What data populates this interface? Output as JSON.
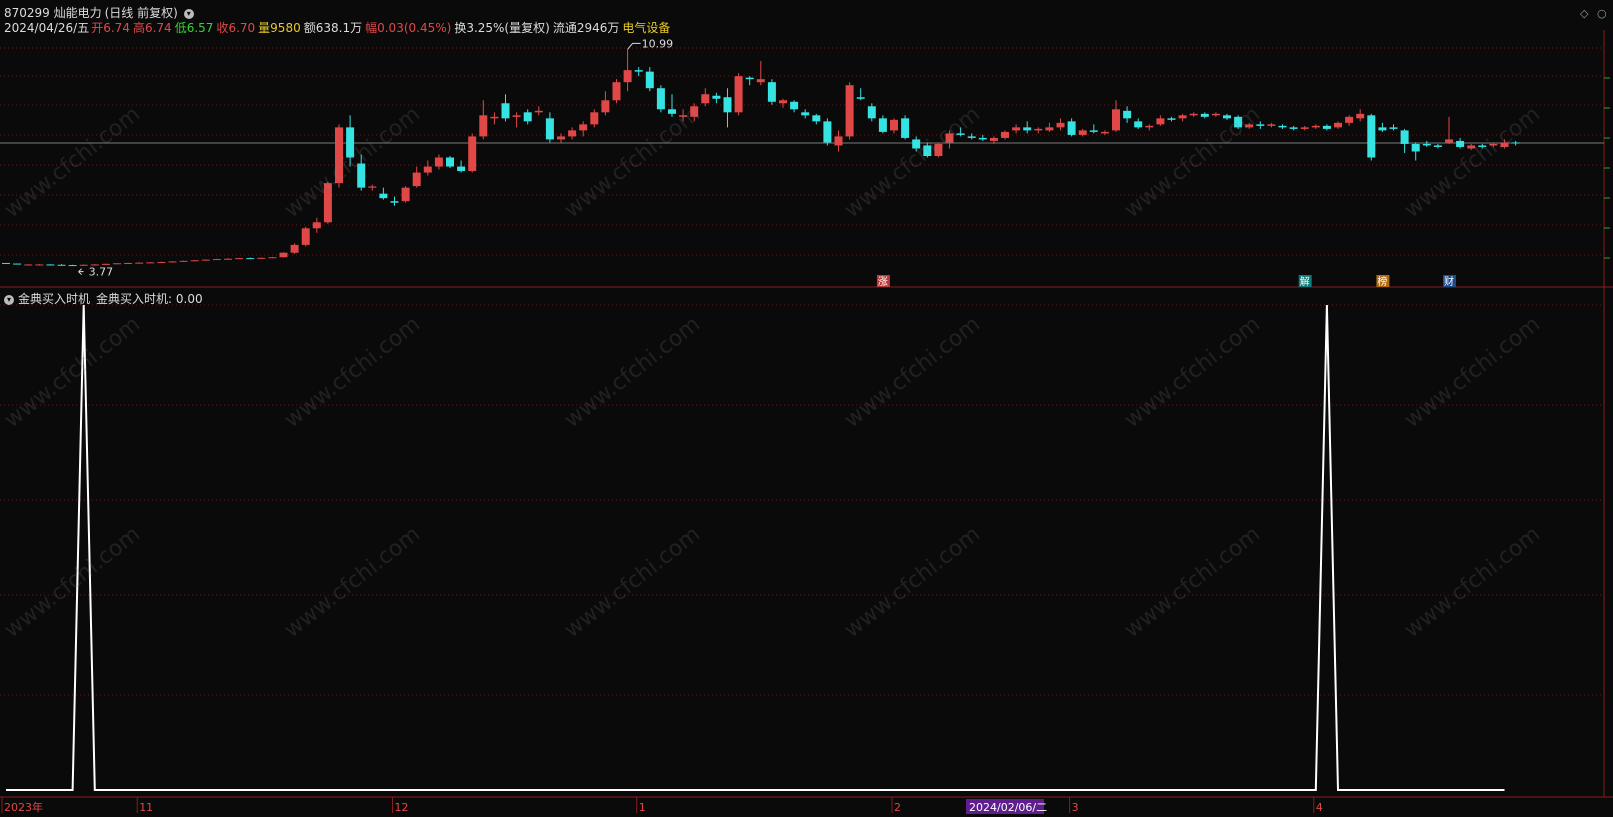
{
  "header": {
    "code_name": "870299 灿能电力",
    "period": "(日线 前复权)",
    "date": "2024/04/26/五",
    "open_label": "开",
    "open": "6.74",
    "high_label": "高",
    "high": "6.74",
    "low_label": "低",
    "low": "6.57",
    "close_label": "收",
    "close": "6.70",
    "vol_label": "量",
    "vol": "9580",
    "amount_label": "额",
    "amount": "638.1万",
    "change_label": "幅",
    "change": "0.03(0.45%)",
    "turnover": "换3.25%(量复权)",
    "float": "流通2946万",
    "sector": "电气设备"
  },
  "indicator": {
    "name": "金典买入时机",
    "value_text": "金典买入时机: 0.00"
  },
  "markers": {
    "high_label": "10.99",
    "low_label": "3.77",
    "events": [
      "涨",
      "解",
      "榜",
      "财"
    ]
  },
  "xaxis": {
    "labels": [
      "2023年",
      "11",
      "12",
      "1",
      "2",
      "3",
      "4"
    ],
    "cursor_date": "2024/02/06/二"
  },
  "watermark": "www.cfchi.com",
  "colors": {
    "up": "#e04848",
    "down": "#35e3e3",
    "bg": "#0a0a0a",
    "grid": "#6a1a1a",
    "line": "#ffffff",
    "accent_yellow": "#e6c829",
    "cursor_bg": "#5e1e8e"
  },
  "chart_data": [
    {
      "type": "candlestick",
      "title": "870299 灿能电力 (日线 前复权)",
      "price_range": [
        3.6,
        11.3
      ],
      "high_marker": 10.99,
      "low_marker": 3.77,
      "candles_ohlc": [
        [
          3.9,
          3.9,
          3.89,
          3.89
        ],
        [
          3.88,
          3.88,
          3.87,
          3.87
        ],
        [
          3.85,
          3.86,
          3.84,
          3.85
        ],
        [
          3.85,
          3.87,
          3.84,
          3.85
        ],
        [
          3.85,
          3.86,
          3.84,
          3.84
        ],
        [
          3.84,
          3.86,
          3.83,
          3.83
        ],
        [
          3.83,
          3.84,
          3.81,
          3.82
        ],
        [
          3.82,
          3.85,
          3.81,
          3.84
        ],
        [
          3.84,
          3.86,
          3.83,
          3.85
        ],
        [
          3.85,
          3.88,
          3.84,
          3.87
        ],
        [
          3.87,
          3.89,
          3.86,
          3.89
        ],
        [
          3.89,
          3.91,
          3.87,
          3.9
        ],
        [
          3.9,
          3.92,
          3.89,
          3.91
        ],
        [
          3.91,
          3.93,
          3.9,
          3.92
        ],
        [
          3.92,
          3.94,
          3.9,
          3.93
        ],
        [
          3.93,
          3.96,
          3.92,
          3.95
        ],
        [
          3.95,
          3.98,
          3.94,
          3.97
        ],
        [
          3.97,
          4.0,
          3.96,
          3.99
        ],
        [
          3.99,
          4.02,
          3.98,
          4.01
        ],
        [
          4.01,
          4.04,
          4.0,
          4.03
        ],
        [
          4.03,
          4.06,
          4.01,
          4.04
        ],
        [
          4.04,
          4.07,
          4.03,
          4.06
        ],
        [
          4.06,
          4.08,
          4.04,
          4.05
        ],
        [
          4.05,
          4.08,
          4.04,
          4.07
        ],
        [
          4.07,
          4.1,
          4.06,
          4.09
        ],
        [
          4.09,
          4.25,
          4.08,
          4.24
        ],
        [
          4.24,
          4.55,
          4.2,
          4.5
        ],
        [
          4.5,
          5.1,
          4.45,
          5.05
        ],
        [
          5.05,
          5.4,
          4.9,
          5.25
        ],
        [
          5.25,
          6.6,
          5.2,
          6.55
        ],
        [
          6.55,
          8.5,
          6.4,
          8.4
        ],
        [
          8.4,
          8.8,
          7.1,
          7.4
        ],
        [
          7.2,
          7.5,
          6.3,
          6.4
        ],
        [
          6.4,
          6.5,
          6.3,
          6.44
        ],
        [
          6.2,
          6.4,
          6.0,
          6.05
        ],
        [
          5.95,
          6.1,
          5.8,
          5.9
        ],
        [
          5.95,
          6.45,
          5.9,
          6.4
        ],
        [
          6.45,
          7.1,
          6.4,
          6.9
        ],
        [
          6.9,
          7.3,
          6.8,
          7.1
        ],
        [
          7.1,
          7.5,
          7.0,
          7.4
        ],
        [
          7.4,
          7.45,
          7.05,
          7.1
        ],
        [
          7.1,
          7.3,
          6.9,
          6.95
        ],
        [
          6.95,
          8.2,
          6.9,
          8.1
        ],
        [
          8.1,
          9.3,
          8.0,
          8.8
        ],
        [
          8.7,
          8.9,
          8.5,
          8.75
        ],
        [
          9.2,
          9.5,
          8.6,
          8.7
        ],
        [
          8.75,
          8.9,
          8.4,
          8.8
        ],
        [
          8.9,
          9.0,
          8.5,
          8.6
        ],
        [
          8.9,
          9.1,
          8.8,
          8.95
        ],
        [
          8.7,
          8.9,
          7.9,
          8.0
        ],
        [
          8.0,
          8.2,
          7.9,
          8.1
        ],
        [
          8.1,
          8.4,
          8.0,
          8.3
        ],
        [
          8.3,
          8.6,
          8.1,
          8.5
        ],
        [
          8.5,
          9.0,
          8.4,
          8.9
        ],
        [
          8.9,
          9.6,
          8.8,
          9.3
        ],
        [
          9.3,
          10.0,
          9.2,
          9.9
        ],
        [
          9.9,
          10.99,
          9.6,
          10.3
        ],
        [
          10.3,
          10.4,
          10.1,
          10.25
        ],
        [
          10.25,
          10.4,
          9.6,
          9.7
        ],
        [
          9.7,
          9.8,
          8.9,
          9.0
        ],
        [
          9.0,
          9.5,
          8.75,
          8.85
        ],
        [
          8.75,
          9.0,
          8.6,
          8.8
        ],
        [
          8.75,
          9.2,
          8.6,
          9.1
        ],
        [
          9.2,
          9.7,
          9.1,
          9.5
        ],
        [
          9.45,
          9.55,
          9.2,
          9.35
        ],
        [
          9.4,
          9.7,
          8.4,
          8.9
        ],
        [
          8.9,
          10.2,
          8.8,
          10.1
        ],
        [
          10.05,
          10.1,
          9.8,
          10.0
        ],
        [
          9.9,
          10.6,
          9.8,
          10.0
        ],
        [
          9.9,
          10.0,
          9.15,
          9.25
        ],
        [
          9.2,
          9.35,
          9.05,
          9.3
        ],
        [
          9.25,
          9.3,
          8.9,
          9.0
        ],
        [
          8.9,
          9.0,
          8.7,
          8.8
        ],
        [
          8.8,
          8.85,
          8.5,
          8.6
        ],
        [
          8.6,
          8.7,
          7.8,
          7.9
        ],
        [
          7.8,
          8.3,
          7.6,
          8.1
        ],
        [
          8.1,
          9.9,
          8.0,
          9.8
        ],
        [
          9.4,
          9.7,
          9.3,
          9.35
        ],
        [
          9.1,
          9.2,
          8.6,
          8.7
        ],
        [
          8.7,
          8.8,
          8.2,
          8.25
        ],
        [
          8.3,
          8.7,
          8.2,
          8.65
        ],
        [
          8.7,
          8.8,
          8.0,
          8.05
        ],
        [
          8.0,
          8.1,
          7.6,
          7.7
        ],
        [
          7.8,
          7.9,
          7.4,
          7.45
        ],
        [
          7.45,
          7.9,
          7.4,
          7.85
        ],
        [
          7.9,
          8.3,
          7.7,
          8.2
        ],
        [
          8.2,
          8.4,
          8.1,
          8.15
        ],
        [
          8.1,
          8.2,
          8.0,
          8.05
        ],
        [
          8.05,
          8.15,
          7.95,
          8.0
        ],
        [
          7.95,
          8.1,
          7.85,
          8.05
        ],
        [
          8.05,
          8.3,
          8.0,
          8.25
        ],
        [
          8.3,
          8.5,
          8.2,
          8.4
        ],
        [
          8.4,
          8.6,
          8.2,
          8.3
        ],
        [
          8.3,
          8.4,
          8.2,
          8.35
        ],
        [
          8.3,
          8.55,
          8.25,
          8.4
        ],
        [
          8.4,
          8.7,
          8.3,
          8.55
        ],
        [
          8.6,
          8.7,
          8.1,
          8.15
        ],
        [
          8.15,
          8.35,
          8.1,
          8.3
        ],
        [
          8.3,
          8.5,
          8.2,
          8.25
        ],
        [
          8.2,
          8.3,
          8.15,
          8.25
        ],
        [
          8.3,
          9.3,
          8.25,
          9.0
        ],
        [
          8.95,
          9.1,
          8.55,
          8.7
        ],
        [
          8.6,
          8.7,
          8.35,
          8.4
        ],
        [
          8.4,
          8.5,
          8.3,
          8.45
        ],
        [
          8.5,
          8.8,
          8.45,
          8.7
        ],
        [
          8.7,
          8.75,
          8.6,
          8.65
        ],
        [
          8.7,
          8.85,
          8.6,
          8.8
        ],
        [
          8.8,
          8.9,
          8.75,
          8.85
        ],
        [
          8.85,
          8.9,
          8.7,
          8.75
        ],
        [
          8.8,
          8.9,
          8.75,
          8.85
        ],
        [
          8.8,
          8.85,
          8.65,
          8.7
        ],
        [
          8.75,
          8.8,
          8.35,
          8.4
        ],
        [
          8.4,
          8.55,
          8.35,
          8.5
        ],
        [
          8.5,
          8.6,
          8.35,
          8.45
        ],
        [
          8.45,
          8.55,
          8.4,
          8.5
        ],
        [
          8.45,
          8.5,
          8.35,
          8.4
        ],
        [
          8.4,
          8.45,
          8.3,
          8.35
        ],
        [
          8.35,
          8.45,
          8.3,
          8.4
        ],
        [
          8.4,
          8.5,
          8.35,
          8.45
        ],
        [
          8.45,
          8.5,
          8.3,
          8.35
        ],
        [
          8.4,
          8.6,
          8.35,
          8.55
        ],
        [
          8.55,
          8.8,
          8.45,
          8.75
        ],
        [
          8.7,
          9.0,
          8.6,
          8.85
        ],
        [
          8.8,
          8.85,
          7.3,
          7.4
        ],
        [
          8.4,
          8.55,
          8.25,
          8.3
        ],
        [
          8.4,
          8.5,
          8.3,
          8.35
        ],
        [
          8.3,
          8.35,
          7.55,
          7.85
        ],
        [
          7.85,
          7.9,
          7.3,
          7.6
        ],
        [
          7.85,
          7.95,
          7.75,
          7.8
        ],
        [
          7.8,
          7.85,
          7.7,
          7.75
        ],
        [
          7.9,
          8.75,
          7.85,
          8.0
        ],
        [
          7.95,
          8.05,
          7.7,
          7.75
        ],
        [
          7.7,
          7.85,
          7.65,
          7.8
        ],
        [
          7.8,
          7.85,
          7.7,
          7.75
        ],
        [
          7.8,
          7.9,
          7.75,
          7.85
        ],
        [
          7.75,
          8.0,
          7.7,
          7.9
        ],
        [
          7.9,
          7.95,
          7.8,
          7.88
        ]
      ]
    },
    {
      "type": "line",
      "title": "金典买入时机",
      "ylim": [
        0,
        1
      ],
      "series": [
        {
          "name": "金典买入时机",
          "spikes_at_index": [
            7,
            119
          ],
          "values_note_free": true,
          "values": [
            0,
            0,
            0,
            0,
            0,
            0,
            0,
            1,
            0,
            0,
            0,
            0,
            0,
            0,
            0,
            0,
            0,
            0,
            0,
            0,
            0,
            0,
            0,
            0,
            0,
            0,
            0,
            0,
            0,
            0,
            0,
            0,
            0,
            0,
            0,
            0,
            0,
            0,
            0,
            0,
            0,
            0,
            0,
            0,
            0,
            0,
            0,
            0,
            0,
            0,
            0,
            0,
            0,
            0,
            0,
            0,
            0,
            0,
            0,
            0,
            0,
            0,
            0,
            0,
            0,
            0,
            0,
            0,
            0,
            0,
            0,
            0,
            0,
            0,
            0,
            0,
            0,
            0,
            0,
            0,
            0,
            0,
            0,
            0,
            0,
            0,
            0,
            0,
            0,
            0,
            0,
            0,
            0,
            0,
            0,
            0,
            0,
            0,
            0,
            0,
            0,
            0,
            0,
            0,
            0,
            0,
            0,
            0,
            0,
            0,
            0,
            0,
            0,
            0,
            0,
            0,
            0,
            0,
            0,
            1,
            0,
            0,
            0,
            0,
            0,
            0,
            0,
            0,
            0,
            0,
            0,
            0,
            0,
            0,
            0,
            0
          ]
        }
      ]
    }
  ]
}
